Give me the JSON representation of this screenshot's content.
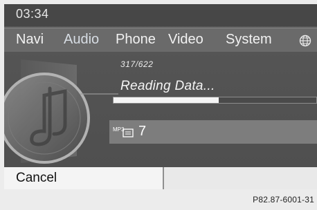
{
  "status_bar": {
    "time": "03:34"
  },
  "menu": {
    "items": [
      {
        "label": "Navi",
        "active": false
      },
      {
        "label": "Audio",
        "active": true
      },
      {
        "label": "Phone",
        "active": false
      },
      {
        "label": "Video",
        "active": false
      },
      {
        "label": "System",
        "active": false
      }
    ],
    "globe_icon": "globe-icon"
  },
  "media": {
    "track_count": "317/622",
    "status": "Reading Data...",
    "progress": 0.52,
    "format_icon": "mp3-icon",
    "format_label": "MP3",
    "track_number": "7"
  },
  "bottom": {
    "cancel_label": "Cancel"
  },
  "footer": {
    "image_ref": "P82.87-6001-31"
  },
  "colors": {
    "screen_bg": "#555555",
    "menu_bg": "#6a6a6a",
    "progress_fill": "#f5f5f5",
    "track_row_bg": "#7d7d7d",
    "bottom_bar_bg": "#f4f4f4"
  }
}
